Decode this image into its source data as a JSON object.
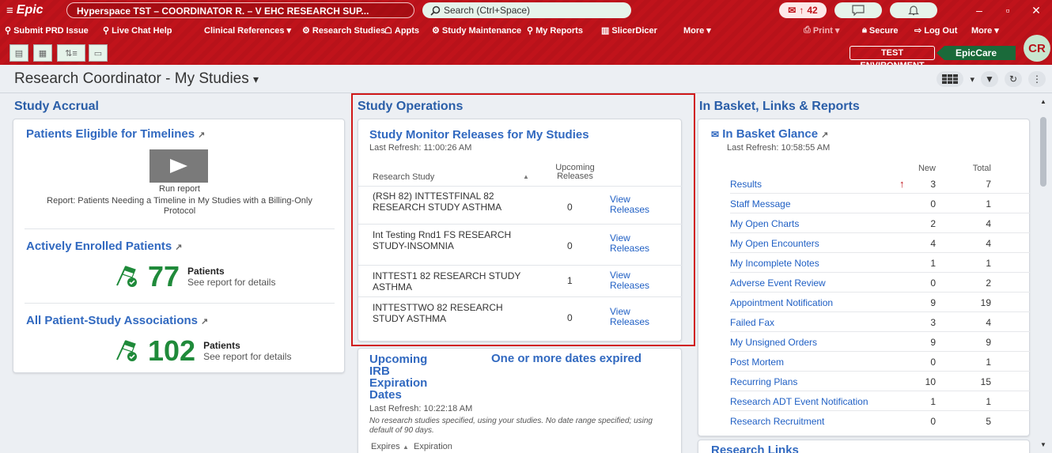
{
  "topbar": {
    "logo": "Epic",
    "window_title": "Hyperspace TST – COORDINATOR R. – V EHC RESEARCH SUP...",
    "search_placeholder": "Search (Ctrl+Space)",
    "mail_count": "42",
    "actions": [
      "Submit PRD Issue",
      "Live Chat Help",
      "Clinical References",
      "Research Studies",
      "Appts",
      "Study Maintenance",
      "My Reports",
      "SlicerDicer",
      "More"
    ],
    "right_actions": [
      "Print",
      "Secure",
      "Log Out",
      "More"
    ],
    "user_initials": "CR",
    "environment": "TEST ENVIRONMENT",
    "app": "EpicCare"
  },
  "page": {
    "title": "Research Coordinator - My Studies"
  },
  "accrual": {
    "column_title": "Study Accrual",
    "eligible": {
      "title": "Patients Eligible for Timelines",
      "run_label": "Run report",
      "report_desc": "Report: Patients Needing a Timeline in My Studies with a Billing-Only Protocol"
    },
    "active": {
      "title": "Actively Enrolled Patients",
      "count": "77",
      "label": "Patients",
      "sub": "See report for details"
    },
    "all": {
      "title": "All Patient-Study Associations",
      "count": "102",
      "label": "Patients",
      "sub": "See report for details"
    }
  },
  "operations": {
    "column_title": "Study Operations",
    "monitor": {
      "title": "Study Monitor Releases for My Studies",
      "last_refresh": "Last Refresh: 11:00:26 AM",
      "col_study": "Research Study",
      "col_upcoming": "Upcoming",
      "col_releases": "Releases",
      "rows": [
        {
          "name": "(RSH 82) INTTESTFINAL 82 RESEARCH STUDY ASTHMA",
          "count": "0",
          "link1": "View",
          "link2": "Releases"
        },
        {
          "name": "Int Testing Rnd1 FS RESEARCH STUDY-INSOMNIA",
          "count": "0",
          "link1": "View",
          "link2": "Releases"
        },
        {
          "name": "INTTEST1 82 RESEARCH STUDY ASTHMA",
          "count": "1",
          "link1": "View",
          "link2": "Releases"
        },
        {
          "name": "INTTESTTWO 82 RESEARCH STUDY ASTHMA",
          "count": "0",
          "link1": "View",
          "link2": "Releases"
        }
      ]
    },
    "irb": {
      "title_1": "Upcoming",
      "title_2": "IRB",
      "title_3": "Expiration",
      "title_4": "Dates",
      "alert": "One or more dates expired",
      "last_refresh": "Last Refresh: 10:22:18 AM",
      "note": "No research studies specified, using your studies. No date range specified; using default of 90 days.",
      "col_expires": "Expires",
      "col_expiration": "Expiration"
    }
  },
  "inbasket": {
    "column_title": "In Basket, Links & Reports",
    "glance_title": "In Basket Glance",
    "last_refresh": "Last Refresh: 10:58:55 AM",
    "col_new": "New",
    "col_total": "Total",
    "rows": [
      {
        "name": "Results",
        "new": "3",
        "total": "7"
      },
      {
        "name": "Staff Message",
        "new": "0",
        "total": "1"
      },
      {
        "name": "My Open Charts",
        "new": "2",
        "total": "4"
      },
      {
        "name": "My Open Encounters",
        "new": "4",
        "total": "4"
      },
      {
        "name": "My Incomplete Notes",
        "new": "1",
        "total": "1"
      },
      {
        "name": "Adverse Event Review",
        "new": "0",
        "total": "2"
      },
      {
        "name": "Appointment Notification",
        "new": "9",
        "total": "19"
      },
      {
        "name": "Failed Fax",
        "new": "3",
        "total": "4"
      },
      {
        "name": "My Unsigned Orders",
        "new": "9",
        "total": "9"
      },
      {
        "name": "Post Mortem",
        "new": "0",
        "total": "1"
      },
      {
        "name": "Recurring Plans",
        "new": "10",
        "total": "15"
      },
      {
        "name": "Research ADT Event Notification",
        "new": "1",
        "total": "1"
      },
      {
        "name": "Research Recruitment",
        "new": "0",
        "total": "5"
      }
    ],
    "research_links": "Research Links"
  }
}
